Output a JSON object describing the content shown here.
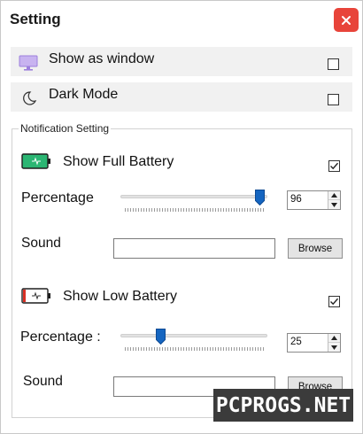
{
  "window": {
    "title": "Setting"
  },
  "options": {
    "show_as_window": {
      "label": "Show as window",
      "checked": false,
      "icon": "monitor-icon"
    },
    "dark_mode": {
      "label": "Dark Mode",
      "checked": false,
      "icon": "moon-icon"
    }
  },
  "notification": {
    "group_title": "Notification Setting",
    "full_battery": {
      "label": "Show Full Battery",
      "checked": true,
      "icon": "full-battery-icon",
      "percentage_label": "Percentage",
      "percentage_value": "96",
      "slider_level": 96,
      "sound_label": "Sound",
      "sound_value": "",
      "browse_label": "Browse"
    },
    "low_battery": {
      "label": "Show Low Battery",
      "checked": true,
      "icon": "low-battery-icon",
      "percentage_label": "Percentage :",
      "percentage_value": "25",
      "slider_level": 25,
      "sound_label": "Sound",
      "sound_value": "",
      "browse_label": "Browse"
    }
  },
  "watermark": {
    "text": "PCPROGS.NET"
  },
  "colors": {
    "close": "#e8443a",
    "row_bg": "#f1f1f1",
    "thumb": "#1565c0",
    "battery_full": "#2bb673",
    "battery_low": "#d93025"
  }
}
